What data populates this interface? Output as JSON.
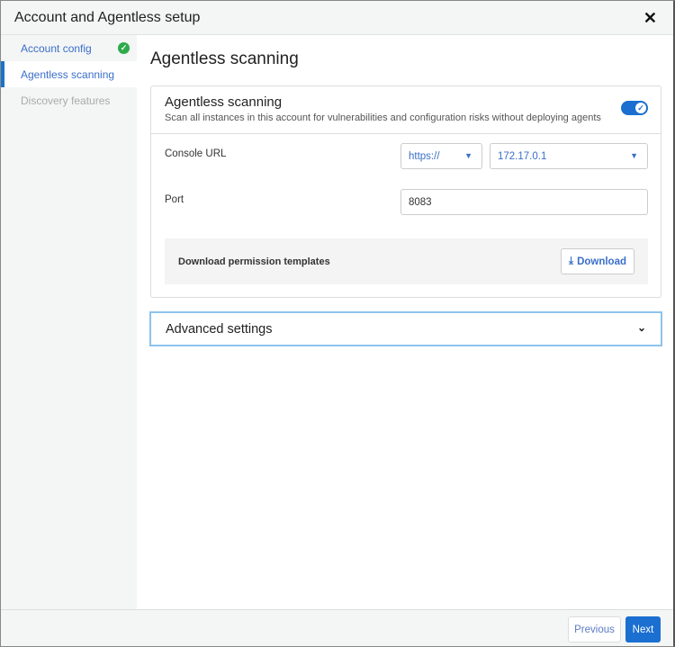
{
  "dialog": {
    "title": "Account and Agentless setup"
  },
  "sidebar": {
    "items": [
      {
        "label": "Account config",
        "state": "done"
      },
      {
        "label": "Agentless scanning",
        "state": "active"
      },
      {
        "label": "Discovery features",
        "state": "disabled"
      }
    ]
  },
  "main": {
    "title": "Agentless scanning",
    "card": {
      "heading": "Agentless scanning",
      "description": "Scan all instances in this account for vulnerabilities and configuration risks without deploying agents",
      "toggle_on": true,
      "console_url_label": "Console URL",
      "protocol": "https://",
      "host": "172.17.0.1",
      "port_label": "Port",
      "port": "8083",
      "download_label": "Download permission templates",
      "download_button": "Download"
    },
    "advanced": "Advanced settings"
  },
  "footer": {
    "previous": "Previous",
    "next": "Next"
  },
  "colors": {
    "accent": "#1a6fd0",
    "success": "#2eaa4a"
  }
}
